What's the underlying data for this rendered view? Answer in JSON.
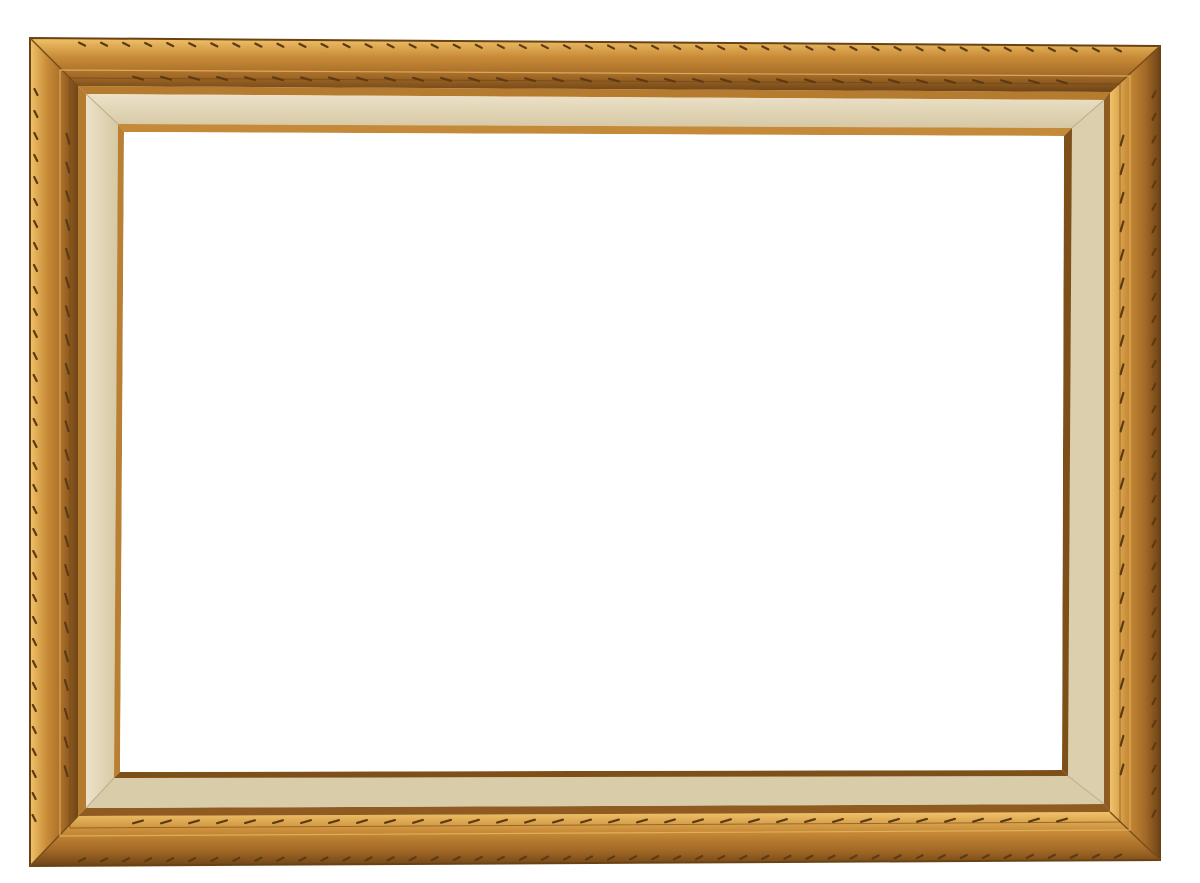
{
  "image": {
    "subject": "gilded-wood-picture-frame",
    "orientation": "landscape",
    "colors": {
      "background": "#ffffff",
      "gold_light": "#e0b25a",
      "gold_mid": "#c58a36",
      "gold_dark": "#8a5a1f",
      "gold_deep": "#5e3a12",
      "linen_liner": "#e8dcc0",
      "linen_shadow": "#cbbd9a",
      "opening": "#ffffff"
    },
    "carving_pattern": "twisted-rope-diagonal-notches"
  }
}
